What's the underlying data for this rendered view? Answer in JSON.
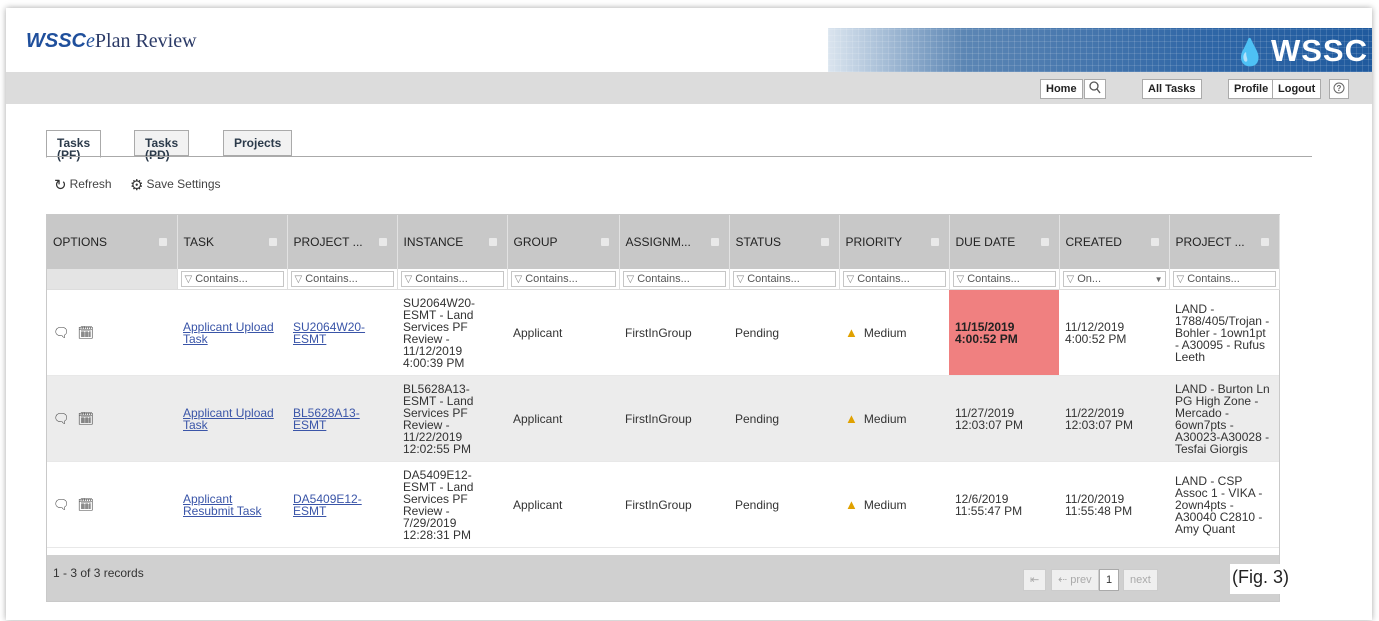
{
  "app": {
    "title_prefix": "WSSC",
    "title_e": "e",
    "title_suffix": "Plan Review",
    "brand": "WSSC",
    "brand_icon": "water-drop-icon"
  },
  "nav": {
    "home": "Home",
    "search_icon": "search-icon",
    "all_tasks": "All Tasks",
    "profile": "Profile",
    "logout": "Logout",
    "help_icon": "help-icon"
  },
  "tabs": [
    {
      "label": "Tasks (PF)",
      "active": true
    },
    {
      "label": "Tasks (PD)",
      "active": false
    },
    {
      "label": "Projects",
      "active": false
    }
  ],
  "toolbar": {
    "refresh": "Refresh",
    "save_settings": "Save Settings"
  },
  "grid": {
    "columns": [
      "OPTIONS",
      "TASK",
      "PROJECT ...",
      "INSTANCE",
      "GROUP",
      "ASSIGNM...",
      "STATUS",
      "PRIORITY",
      "DUE DATE",
      "CREATED",
      "PROJECT ..."
    ],
    "filters": [
      "",
      "Contains...",
      "Contains...",
      "Contains...",
      "Contains...",
      "Contains...",
      "Contains...",
      "Contains...",
      "Contains...",
      "On...",
      "Contains..."
    ],
    "rows": [
      {
        "task": "Applicant Upload Task",
        "project": "SU2064W20-ESMT",
        "instance": "SU2064W20-ESMT - Land Services PF Review - 11/12/2019 4:00:39 PM",
        "group": "Applicant",
        "assignment": "FirstInGroup",
        "status": "Pending",
        "priority": "Medium",
        "due": "11/15/2019 4:00:52 PM",
        "created": "11/12/2019 4:00:52 PM",
        "project_desc": "LAND - 1788/405/Trojan - Bohler - 1own1pt - A30095 - Rufus Leeth",
        "overdue": true
      },
      {
        "task": "Applicant Upload Task",
        "project": "BL5628A13-ESMT",
        "instance": "BL5628A13-ESMT - Land Services PF Review - 11/22/2019 12:02:55 PM",
        "group": "Applicant",
        "assignment": "FirstInGroup",
        "status": "Pending",
        "priority": "Medium",
        "due": "11/27/2019 12:03:07 PM",
        "created": "11/22/2019 12:03:07 PM",
        "project_desc": "LAND - Burton Ln PG High Zone - Mercado - 6own7pts - A30023-A30028 - Tesfai Giorgis",
        "overdue": false
      },
      {
        "task": "Applicant Resubmit Task",
        "project": "DA5409E12-ESMT",
        "instance": "DA5409E12-ESMT - Land Services PF Review - 7/29/2019 12:28:31 PM",
        "group": "Applicant",
        "assignment": "FirstInGroup",
        "status": "Pending",
        "priority": "Medium",
        "due": "12/6/2019 11:55:47 PM",
        "created": "11/20/2019 11:55:48 PM",
        "project_desc": "LAND - CSP Assoc 1 - VIKA - 2own4pts - A30040 C2810 - Amy Quant",
        "overdue": false
      }
    ],
    "records": "1 - 3 of 3 records"
  },
  "pager": {
    "first": "⇤",
    "prev": "prev",
    "page": "1",
    "next": "next"
  },
  "figure_label": "(Fig. 3)",
  "colors": {
    "overdue": "#f08080",
    "header": "#c8c8c8",
    "link": "#3a55a8"
  }
}
